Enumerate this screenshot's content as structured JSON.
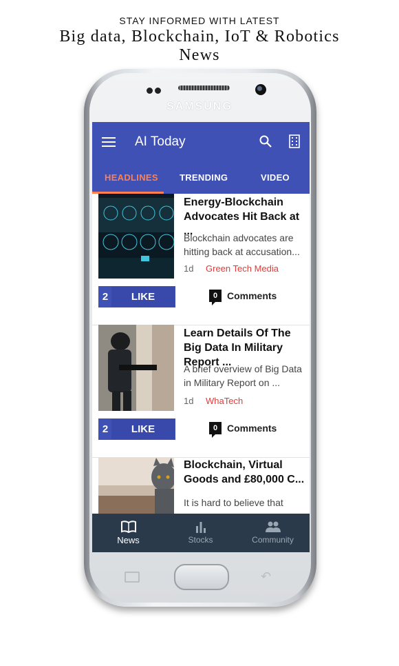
{
  "promo": {
    "line1": "STAY INFORMED WITH LATEST",
    "line2": "Big data, Blockchain, IoT & Robotics",
    "line3": "News"
  },
  "device": {
    "brand": "SAMSUNG"
  },
  "app": {
    "title": "AI Today",
    "tabs": [
      {
        "label": "HEADLINES",
        "active": true
      },
      {
        "label": "TRENDING",
        "active": false
      },
      {
        "label": "VIDEO",
        "active": false
      }
    ]
  },
  "articles": [
    {
      "headline": "Energy-Blockchain Advocates Hit Back at ...",
      "summary": "Blockchain advocates are hitting back at accusation...",
      "age": "1d",
      "source": "Green Tech Media",
      "likes": "2",
      "like_label": "LIKE",
      "comments": "0",
      "comments_label": "Comments"
    },
    {
      "headline": "Learn Details Of The Big Data In Military Report ...",
      "summary": "A brief overview of Big Data in Military Report on ...",
      "age": "1d",
      "source": "WhaTech",
      "likes": "2",
      "like_label": "LIKE",
      "comments": "0",
      "comments_label": "Comments"
    },
    {
      "headline": "Blockchain, Virtual Goods and £80,000 C...",
      "summary": "It is hard to believe that"
    }
  ],
  "bottom_nav": [
    {
      "label": "News",
      "icon": "book-icon",
      "active": true
    },
    {
      "label": "Stocks",
      "icon": "bar-chart-icon",
      "active": false
    },
    {
      "label": "Community",
      "icon": "people-icon",
      "active": false
    }
  ],
  "colors": {
    "app_bar": "#3f51b5",
    "accent": "#ff7f50",
    "source": "#e53935",
    "bottom_nav": "#2b3a4a"
  }
}
